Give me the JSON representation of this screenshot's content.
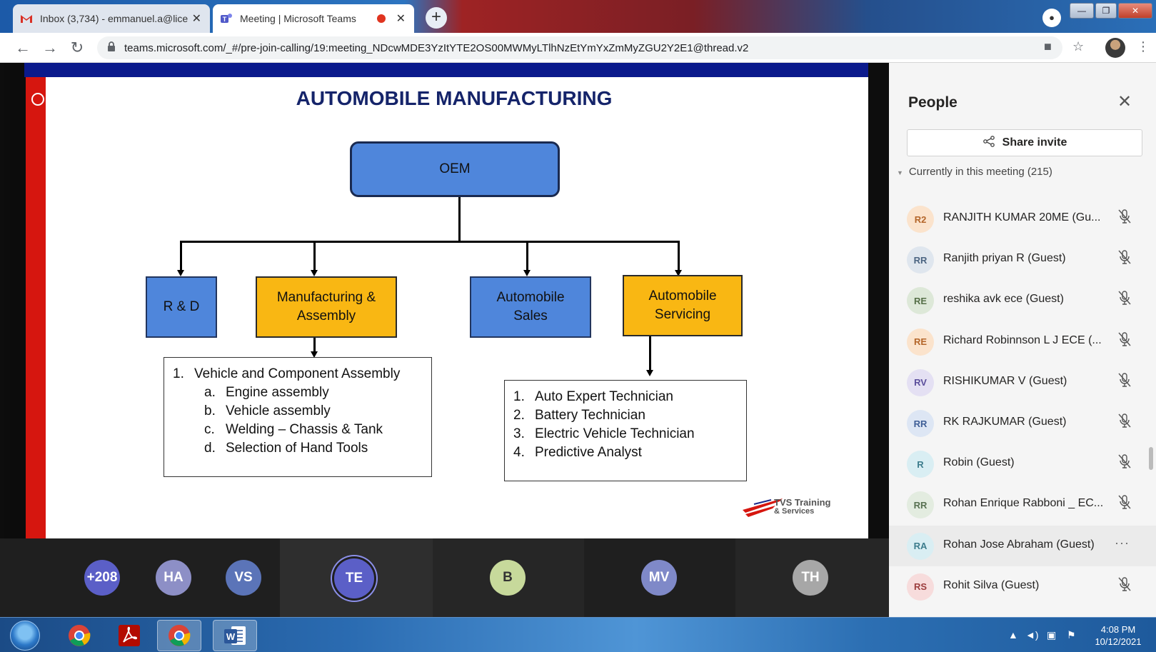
{
  "browser": {
    "tabs": [
      {
        "title": "Inbox (3,734) - emmanuel.a@lice",
        "icon": "gmail-icon"
      },
      {
        "title": "Meeting | Microsoft Teams",
        "icon": "teams-icon",
        "recording": true
      }
    ],
    "new_tab_label": "+",
    "url": "teams.microsoft.com/_#/pre-join-calling/19:meeting_NDcwMDE3YzItYTE2OS00MWMyLTlhNzEtYmYxZmMyZGU2Y2E1@thread.v2",
    "window_buttons": {
      "minimize": "—",
      "restore": "❐",
      "close": "✕"
    }
  },
  "slide": {
    "title": "AUTOMOBILE MANUFACTURING",
    "root": "OEM",
    "branches": [
      "R & D",
      "Manufacturing & Assembly",
      "Automobile Sales",
      "Automobile Servicing"
    ],
    "manufacturing_list": {
      "heading_num": "1.",
      "heading": "Vehicle and Component Assembly",
      "items": [
        {
          "num": "a.",
          "text": "Engine assembly"
        },
        {
          "num": "b.",
          "text": "Vehicle assembly"
        },
        {
          "num": "c.",
          "text": "Welding – Chassis & Tank"
        },
        {
          "num": "d.",
          "text": "Selection of Hand Tools"
        }
      ]
    },
    "servicing_list": [
      {
        "num": "1.",
        "text": "Auto Expert Technician"
      },
      {
        "num": "2.",
        "text": "Battery Technician"
      },
      {
        "num": "3.",
        "text": "Electric Vehicle Technician"
      },
      {
        "num": "4.",
        "text": "Predictive Analyst"
      }
    ],
    "logo_text": [
      "TVS Training",
      "& Services"
    ]
  },
  "participants_strip": [
    {
      "initials": "+208",
      "color": "#5b5fc7"
    },
    {
      "initials": "HA",
      "color": "#8d8fc6"
    },
    {
      "initials": "VS",
      "color": "#5b74b8"
    },
    {
      "initials": "TE",
      "color": "#5b5fc7"
    },
    {
      "initials": "B",
      "color": "#c7d99b"
    },
    {
      "initials": "MV",
      "color": "#7f89c8"
    },
    {
      "initials": "TH",
      "color": "#a7a7a7"
    }
  ],
  "people_panel": {
    "title": "People",
    "share_label": "Share invite",
    "section_label": "Currently in this meeting (215)",
    "people": [
      {
        "initials": "R2",
        "name": "RANJITH KUMAR 20ME (Gu...",
        "bg": "#fbe3cc",
        "fg": "#b4662a"
      },
      {
        "initials": "RR",
        "name": "Ranjith priyan R (Guest)",
        "bg": "#dfe6ee",
        "fg": "#4c6582"
      },
      {
        "initials": "RE",
        "name": "reshika avk ece (Guest)",
        "bg": "#dde8d8",
        "fg": "#567048"
      },
      {
        "initials": "RE",
        "name": "Richard Robinnson L J ECE (...",
        "bg": "#fbe3cc",
        "fg": "#b4662a"
      },
      {
        "initials": "RV",
        "name": "RISHIKUMAR V (Guest)",
        "bg": "#e4e0f3",
        "fg": "#5c4f9c"
      },
      {
        "initials": "RR",
        "name": "RK RAJKUMAR (Guest)",
        "bg": "#dde6f4",
        "fg": "#3f5f97"
      },
      {
        "initials": "R",
        "name": "Robin (Guest)",
        "bg": "#d9eef3",
        "fg": "#3d7d8d"
      },
      {
        "initials": "RR",
        "name": "Rohan Enrique Rabboni _ EC...",
        "bg": "#e3ece0",
        "fg": "#587152"
      },
      {
        "initials": "RA",
        "name": "Rohan Jose Abraham (Guest)",
        "bg": "#d9eef3",
        "fg": "#3d7d8d"
      },
      {
        "initials": "RS",
        "name": "Rohit Silva (Guest)",
        "bg": "#f7dcdc",
        "fg": "#9c3d3d"
      }
    ],
    "more_label": "···"
  },
  "taskbar": {
    "apps": [
      "chrome-icon",
      "acrobat-icon",
      "chrome-icon",
      "word-icon"
    ],
    "clock": {
      "time": "4:08 PM",
      "date": "10/12/2021"
    }
  }
}
